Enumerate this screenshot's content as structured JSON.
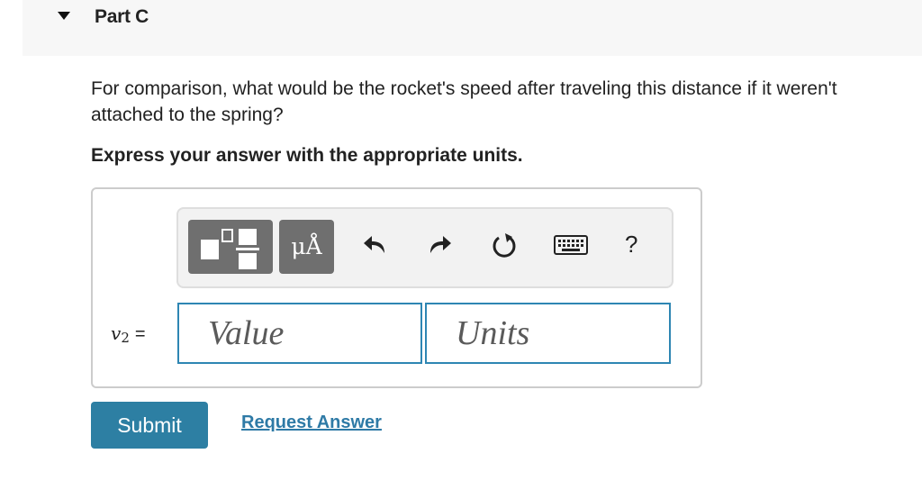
{
  "part": {
    "title": "Part C"
  },
  "question": {
    "text": "For comparison, what would be the rocket's speed after traveling this distance if it weren't attached to the spring?",
    "instruction": "Express your answer with the appropriate units."
  },
  "toolbar": {
    "templates_icon": "templates-icon",
    "units_label": "μÅ",
    "undo_icon": "undo-arrow-icon",
    "redo_icon": "redo-arrow-icon",
    "reset_icon": "reset-icon",
    "keyboard_icon": "keyboard-icon",
    "help_label": "?"
  },
  "answer": {
    "variable": "v",
    "subscript": "2",
    "equals": "=",
    "value_placeholder": "Value",
    "units_placeholder": "Units"
  },
  "actions": {
    "submit_label": "Submit",
    "request_label": "Request Answer"
  },
  "colors": {
    "accent": "#2d7fa3",
    "field_border": "#2e86b3",
    "toolbar_button": "#6f6f6f"
  }
}
